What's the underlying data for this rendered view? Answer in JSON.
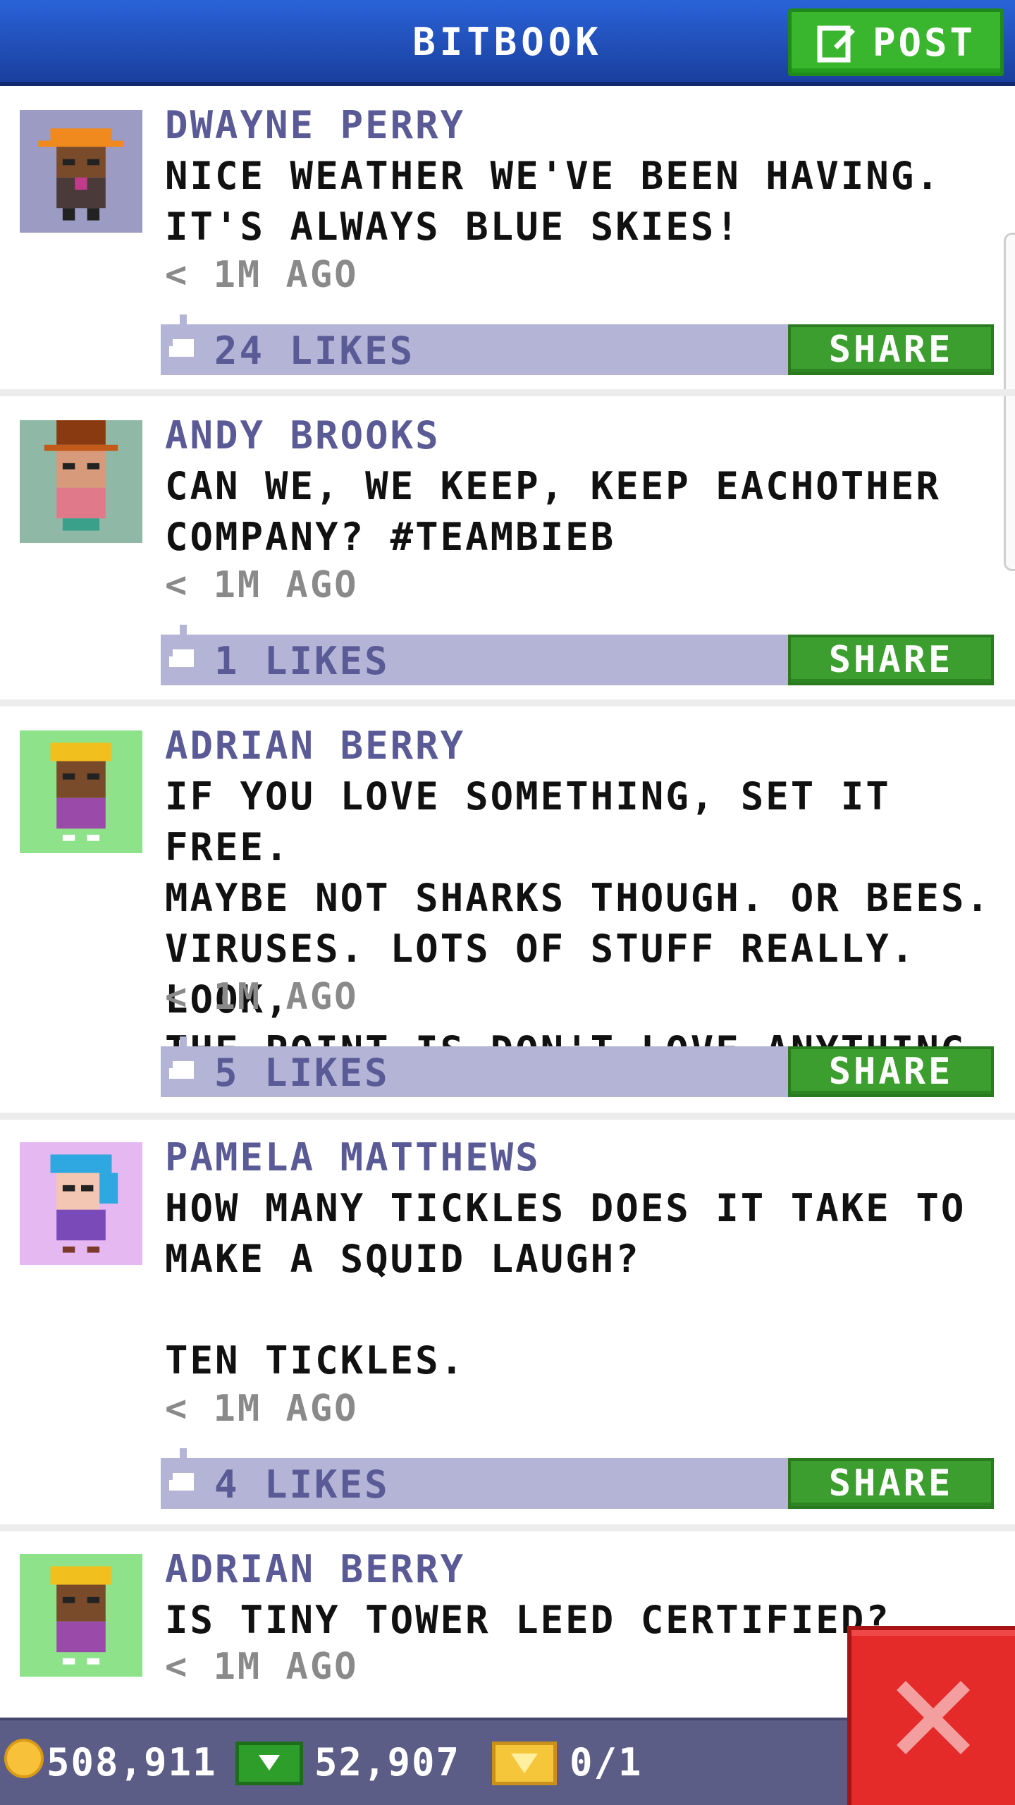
{
  "header": {
    "title": "BITBOOK",
    "post_label": "POST"
  },
  "posts": [
    {
      "author": "DWAYNE PERRY",
      "message": "NICE WEATHER WE'VE BEEN HAVING.\nIT'S ALWAYS BLUE SKIES!",
      "time": "< 1M AGO",
      "likes": "24 LIKES",
      "share_label": "SHARE",
      "avatar_bg": "#9b9bc4"
    },
    {
      "author": "ANDY BROOKS",
      "message": "CAN WE, WE KEEP, KEEP EACHOTHER\nCOMPANY? #TEAMBIEB",
      "time": "< 1M AGO",
      "likes": "1 LIKES",
      "share_label": "SHARE",
      "avatar_bg": "#8fb8a6"
    },
    {
      "author": "ADRIAN BERRY",
      "message": "IF YOU LOVE SOMETHING, SET IT FREE.\nMAYBE NOT SHARKS THOUGH. OR BEES.\nVIRUSES. LOTS OF STUFF REALLY. LOOK,\nTHE POINT IS DON'T LOVE ANYTHING.",
      "time": "< 1M AGO",
      "likes": "5 LIKES",
      "share_label": "SHARE",
      "avatar_bg": "#8ee38a"
    },
    {
      "author": "PAMELA MATTHEWS",
      "message": "HOW MANY TICKLES DOES IT TAKE TO\nMAKE A SQUID LAUGH?\n\nTEN TICKLES.",
      "time": "< 1M AGO",
      "likes": "4 LIKES",
      "share_label": "SHARE",
      "avatar_bg": "#e6b8f2"
    },
    {
      "author": "ADRIAN BERRY",
      "message": "IS TINY TOWER LEED CERTIFIED?",
      "time": "< 1M AGO",
      "avatar_bg": "#8ee38a"
    }
  ],
  "bottom_bar": {
    "coins": "508,911",
    "bux": "52,907",
    "tickets": "0/1"
  },
  "colors": {
    "header": "#1f4fbf",
    "post_button": "#39b52e",
    "share_button": "#3c9e2e",
    "likes_bar": "#b4b4d6",
    "close_button": "#e52a2a"
  },
  "icons": [
    "edit-icon",
    "thumbs-up-icon",
    "coin-icon",
    "bux-icon",
    "ticket-icon",
    "close-icon"
  ]
}
